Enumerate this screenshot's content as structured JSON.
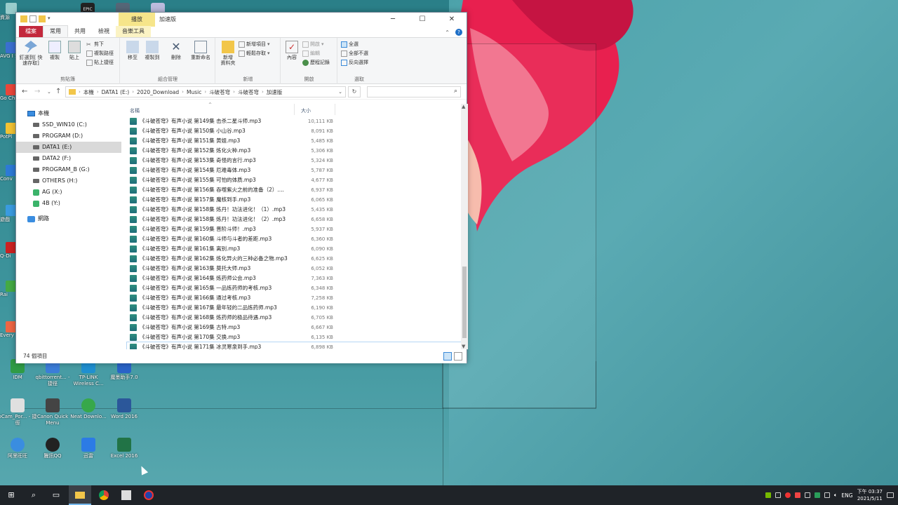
{
  "window": {
    "context_tab": "播放",
    "title": "加速版",
    "tabs": [
      "檔案",
      "常用",
      "共用",
      "檢視",
      "音樂工具"
    ],
    "active_tab_index": 1
  },
  "ribbon": {
    "clipboard": {
      "label": "剪貼簿",
      "pin": "釘選到[\n快速存取]",
      "copy": "複製",
      "paste": "貼上",
      "cut": "剪下",
      "copy_path": "複製路徑",
      "paste_shortcut": "貼上捷徑"
    },
    "organize": {
      "label": "組合管理",
      "move": "移至",
      "copyto": "複製到",
      "delete": "刪除",
      "rename": "重新命名"
    },
    "new": {
      "label": "新增",
      "new_folder": "新增\n資料夾",
      "new_item": "新增項目",
      "easy_access": "輕鬆存取"
    },
    "open": {
      "label": "開啟",
      "properties": "內容",
      "open": "開啟",
      "edit": "編輯",
      "history": "歷程記錄"
    },
    "select": {
      "label": "選取",
      "all": "全選",
      "none": "全部不選",
      "invert": "反向選擇"
    }
  },
  "address": {
    "crumbs": [
      "本機",
      "DATA1 (E:)",
      "2020_Download",
      "Music",
      "斗破苍穹",
      "斗破苍穹",
      "加速版"
    ],
    "search_placeholder": ""
  },
  "nav": {
    "items": [
      {
        "label": "本機",
        "type": "pc"
      },
      {
        "label": "SSD_WIN10 (C:)",
        "type": "drive"
      },
      {
        "label": "PROGRAM (D:)",
        "type": "drive"
      },
      {
        "label": "DATA1 (E:)",
        "type": "drive",
        "selected": true
      },
      {
        "label": "DATA2 (F:)",
        "type": "drive"
      },
      {
        "label": "PROGRAM_B (G:)",
        "type": "drive"
      },
      {
        "label": "OTHERS (H:)",
        "type": "drive"
      },
      {
        "label": "AG (X:)",
        "type": "ag"
      },
      {
        "label": "4B (Y:)",
        "type": "ag"
      },
      {
        "label": "網路",
        "type": "net"
      }
    ]
  },
  "list": {
    "col_name": "名稱",
    "col_size": "大小",
    "rows": [
      {
        "name": "《斗破苍穹》有声小说 第149集 击杀二星斗师.mp3",
        "size": "10,111 KB"
      },
      {
        "name": "《斗破苍穹》有声小说 第150集 小山谷.mp3",
        "size": "8,091 KB"
      },
      {
        "name": "《斗破苍穹》有声小说 第151集 黄姐.mp3",
        "size": "5,485 KB"
      },
      {
        "name": "《斗破苍穹》有声小说 第152集 炼化火种.mp3",
        "size": "5,306 KB"
      },
      {
        "name": "《斗破苍穹》有声小说 第153集 奇怪的言行.mp3",
        "size": "5,324 KB"
      },
      {
        "name": "《斗破苍穹》有声小说 第154集 厄难毒体.mp3",
        "size": "5,787 KB"
      },
      {
        "name": "《斗破苍穹》有声小说 第155集 可怕的体质.mp3",
        "size": "4,677 KB"
      },
      {
        "name": "《斗破苍穹》有声小说 第156集 吞噬紫火之前的准备（2）....",
        "size": "6,937 KB"
      },
      {
        "name": "《斗破苍穹》有声小说 第157集 魔核到手.mp3",
        "size": "6,065 KB"
      },
      {
        "name": "《斗破苍穹》有声小说 第158集 炼丹！功法进化！（1）.mp3",
        "size": "5,435 KB"
      },
      {
        "name": "《斗破苍穹》有声小说 第158集 炼丹！功法进化！（2）.mp3",
        "size": "6,658 KB"
      },
      {
        "name": "《斗破苍穹》有声小说 第159集 晋阶斗师！.mp3",
        "size": "5,937 KB"
      },
      {
        "name": "《斗破苍穹》有声小说 第160集 斗师与斗者的差距.mp3",
        "size": "6,360 KB"
      },
      {
        "name": "《斗破苍穹》有声小说 第161集 离别.mp3",
        "size": "6,090 KB"
      },
      {
        "name": "《斗破苍穹》有声小说 第162集 炼化异火的三种必备之物.mp3",
        "size": "6,625 KB"
      },
      {
        "name": "《斗破苍穹》有声小说 第163集 莫托大师.mp3",
        "size": "6,052 KB"
      },
      {
        "name": "《斗破苍穹》有声小说 第164集 炼药师公会.mp3",
        "size": "7,363 KB"
      },
      {
        "name": "《斗破苍穹》有声小说 第165集 一品炼药师的考核.mp3",
        "size": "6,348 KB"
      },
      {
        "name": "《斗破苍穹》有声小说 第166集 通过考核.mp3",
        "size": "7,258 KB"
      },
      {
        "name": "《斗破苍穹》有声小说 第167集 最年轻的二品炼药师.mp3",
        "size": "6,190 KB"
      },
      {
        "name": "《斗破苍穹》有声小说 第168集 炼药师的极品待遇.mp3",
        "size": "6,705 KB"
      },
      {
        "name": "《斗破苍穹》有声小说 第169集 古特.mp3",
        "size": "6,667 KB"
      },
      {
        "name": "《斗破苍穹》有声小说 第170集 交换.mp3",
        "size": "6,135 KB"
      },
      {
        "name": "《斗破苍穹》有声小说 第171集 冰灵寒泉到手.mp3",
        "size": "6,898 KB",
        "selected": true
      }
    ]
  },
  "status": {
    "count": "74 個項目"
  },
  "desktop": {
    "icons": [
      {
        "label": "IDM"
      },
      {
        "label": "qbittorrent... - 捷徑"
      },
      {
        "label": "TP-LINK Wireless C..."
      },
      {
        "label": "魔墨助手7.0"
      },
      {
        "label": "oCam_Por... - 捷徑"
      },
      {
        "label": "Canon Quick Menu"
      },
      {
        "label": "Neat Downlo..."
      },
      {
        "label": "Word 2016"
      },
      {
        "label": "阿里旺旺"
      },
      {
        "label": "騰訊QQ"
      },
      {
        "label": "迅雷"
      },
      {
        "label": "Excel 2016"
      }
    ],
    "left_strip": [
      "資源",
      "AVG I Sec",
      "Go Chr",
      "PotPl",
      "Conv",
      "遊戲",
      "Q-Di",
      "Rai",
      "Every"
    ],
    "top_icons": [
      "EPIC"
    ]
  },
  "taskbar": {
    "lang": "ENG",
    "time": "下午 03:37",
    "date": "2021/5/11"
  },
  "colors": {
    "file_tab": "#c3283c",
    "context_tab": "#f6e58a",
    "selection": "#cce4f7",
    "taskbar": "#1f2328"
  }
}
